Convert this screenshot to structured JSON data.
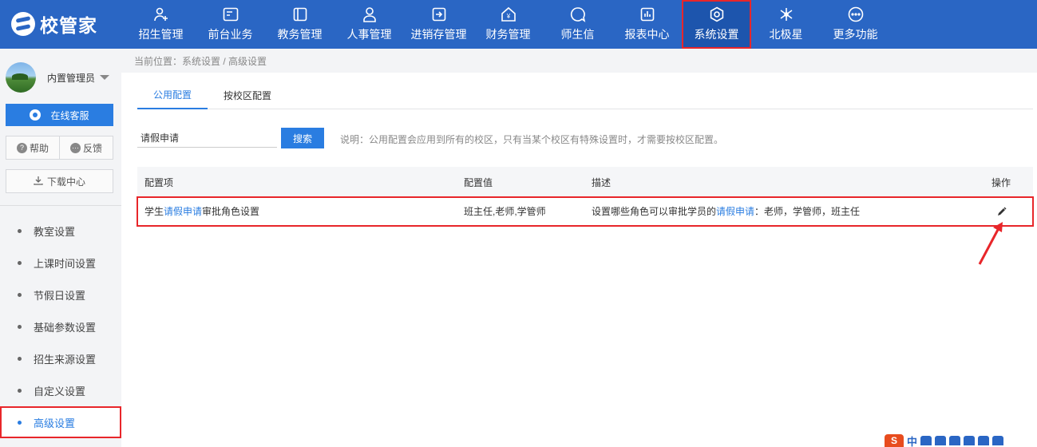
{
  "logo": {
    "text": "校管家"
  },
  "nav": [
    {
      "label": "招生管理",
      "icon": "user-add-icon"
    },
    {
      "label": "前台业务",
      "icon": "card-icon"
    },
    {
      "label": "教务管理",
      "icon": "book-icon"
    },
    {
      "label": "人事管理",
      "icon": "person-icon"
    },
    {
      "label": "进销存管理",
      "icon": "inbox-arrow-icon"
    },
    {
      "label": "财务管理",
      "icon": "yen-house-icon"
    },
    {
      "label": "师生信",
      "icon": "chat-bubble-icon"
    },
    {
      "label": "报表中心",
      "icon": "bar-chart-icon"
    },
    {
      "label": "系统设置",
      "icon": "gear-icon",
      "active": true
    },
    {
      "label": "北极星",
      "icon": "star-icon"
    },
    {
      "label": "更多功能",
      "icon": "more-icon"
    }
  ],
  "sidebar": {
    "user_name": "内置管理员",
    "service_label": "在线客服",
    "help_label": "帮助",
    "feedback_label": "反馈",
    "download_label": "下载中心",
    "menu": [
      {
        "label": "教室设置"
      },
      {
        "label": "上课时间设置"
      },
      {
        "label": "节假日设置"
      },
      {
        "label": "基础参数设置"
      },
      {
        "label": "招生来源设置"
      },
      {
        "label": "自定义设置"
      },
      {
        "label": "高级设置",
        "active": true
      }
    ]
  },
  "breadcrumb": "当前位置：系统设置 / 高级设置",
  "tabs": [
    {
      "label": "公用配置",
      "active": true
    },
    {
      "label": "按校区配置"
    }
  ],
  "search": {
    "value": "请假申请",
    "button_label": "搜索",
    "note": "说明：公用配置会应用到所有的校区，只有当某个校区有特殊设置时，才需要按校区配置。"
  },
  "table": {
    "headers": {
      "item": "配置项",
      "value": "配置值",
      "desc": "描述",
      "ops": "操作"
    },
    "rows": [
      {
        "item_pre": "学生",
        "item_hl": "请假申请",
        "item_post": "审批角色设置",
        "value": "班主任,老师,学管师",
        "desc_pre": "设置哪些角色可以审批学员的",
        "desc_hl": "请假申请",
        "desc_post": "：老师，学管师，班主任"
      }
    ]
  },
  "tray": {
    "input_mode": "中"
  }
}
